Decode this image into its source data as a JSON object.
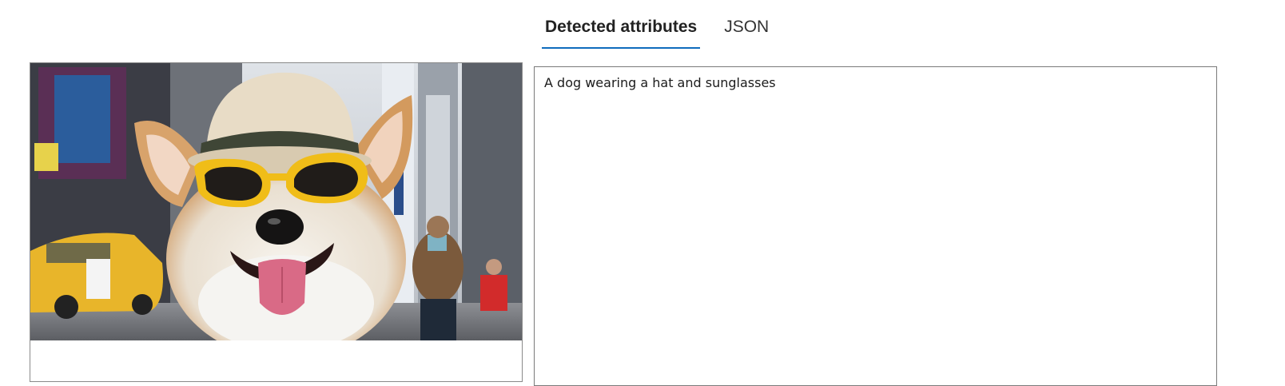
{
  "tabs": [
    {
      "label": "Detected attributes",
      "active": true
    },
    {
      "label": "JSON",
      "active": false
    }
  ],
  "image": {
    "subject": "corgi wearing a hat and yellow sunglasses in a city street"
  },
  "result": {
    "caption": "A dog wearing a hat and sunglasses"
  },
  "colors": {
    "tab_underline": "#0f6cbd",
    "border": "#7a7a7a"
  }
}
